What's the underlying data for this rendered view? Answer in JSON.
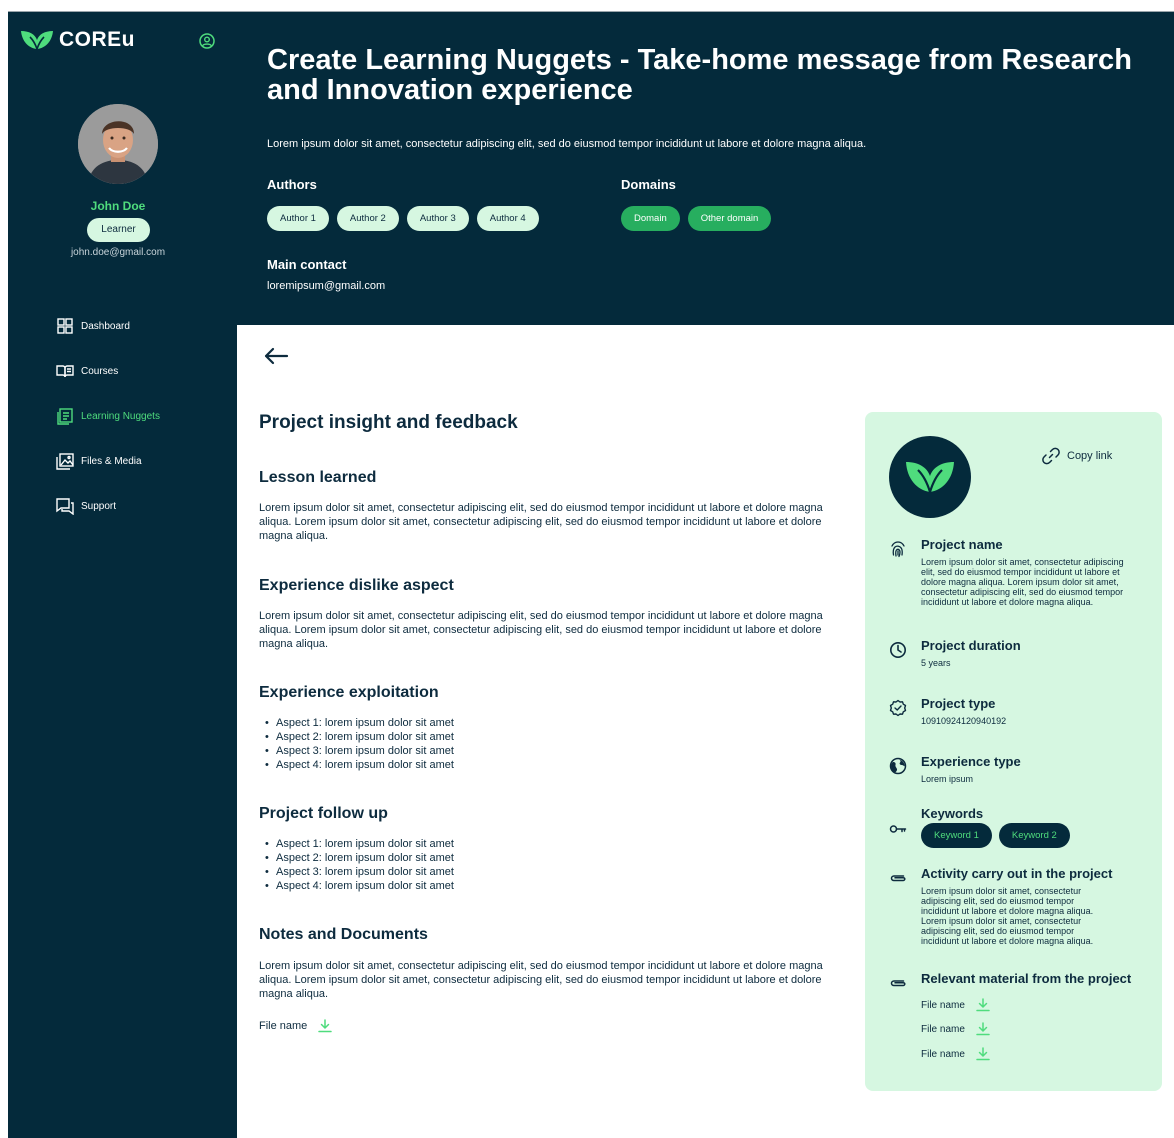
{
  "app": {
    "logo_text": "COREu"
  },
  "user": {
    "name": "John Doe",
    "role": "Learner",
    "email": "john.doe@gmail.com"
  },
  "nav": [
    {
      "label": "Dashboard",
      "icon": "grid-icon",
      "active": false
    },
    {
      "label": "Courses",
      "icon": "book-icon",
      "active": false
    },
    {
      "label": "Learning Nuggets",
      "icon": "document-list-icon",
      "active": true
    },
    {
      "label": "Files & Media",
      "icon": "image-folder-icon",
      "active": false
    },
    {
      "label": "Support",
      "icon": "chat-icon",
      "active": false
    }
  ],
  "header": {
    "title": "Create Learning Nuggets - Take-home message from Research and Innovation experience",
    "description": "Lorem ipsum dolor sit amet, consectetur adipiscing elit, sed do eiusmod tempor incididunt ut labore et dolore magna aliqua.",
    "authors_label": "Authors",
    "authors": [
      "Author 1",
      "Author 2",
      "Author 3",
      "Author 4"
    ],
    "domains_label": "Domains",
    "domains": [
      "Domain",
      "Other domain"
    ],
    "contact_label": "Main contact",
    "contact_email": "loremipsum@gmail.com"
  },
  "main": {
    "heading": "Project insight and feedback",
    "lesson": {
      "title": "Lesson learned",
      "text": "Lorem ipsum dolor sit amet, consectetur adipiscing elit, sed do eiusmod tempor incididunt ut labore et dolore magna aliqua. Lorem ipsum dolor sit amet, consectetur adipiscing elit, sed do eiusmod tempor incididunt ut labore et dolore magna aliqua."
    },
    "dislike": {
      "title": "Experience dislike aspect",
      "text": "Lorem ipsum dolor sit amet, consectetur adipiscing elit, sed do eiusmod tempor incididunt ut labore et dolore magna aliqua. Lorem ipsum dolor sit amet, consectetur adipiscing elit, sed do eiusmod tempor incididunt ut labore et dolore magna aliqua."
    },
    "exploitation": {
      "title": "Experience exploitation",
      "items": [
        "Aspect 1: lorem ipsum dolor sit amet",
        "Aspect 2: lorem ipsum dolor sit amet",
        "Aspect 3: lorem ipsum dolor sit amet",
        "Aspect 4: lorem ipsum dolor sit amet"
      ]
    },
    "followup": {
      "title": "Project follow up",
      "items": [
        "Aspect 1: lorem ipsum dolor sit amet",
        "Aspect 2: lorem ipsum dolor sit amet",
        "Aspect 3: lorem ipsum dolor sit amet",
        "Aspect 4: lorem ipsum dolor sit amet"
      ]
    },
    "notes": {
      "title": "Notes and Documents",
      "text": "Lorem ipsum dolor sit amet, consectetur adipiscing elit, sed do eiusmod tempor incididunt ut labore et dolore magna aliqua. Lorem ipsum dolor sit amet, consectetur adipiscing elit, sed do eiusmod tempor incididunt ut labore et dolore magna aliqua.",
      "file": "File name"
    }
  },
  "card": {
    "copy_link": "Copy link",
    "project_name": {
      "title": "Project name",
      "text": "Lorem ipsum dolor sit amet, consectetur adipiscing elit, sed do eiusmod tempor incididunt ut labore et dolore magna aliqua. Lorem ipsum dolor sit amet, consectetur adipiscing elit, sed do eiusmod tempor incididunt ut labore et dolore magna aliqua."
    },
    "duration": {
      "title": "Project duration",
      "text": "5 years"
    },
    "type": {
      "title": "Project type",
      "text": "10910924120940192"
    },
    "experience": {
      "title": "Experience type",
      "text": "Lorem ipsum"
    },
    "keywords": {
      "title": "Keywords",
      "items": [
        "Keyword 1",
        "Keyword 2"
      ]
    },
    "activity": {
      "title": "Activity carry out in the project",
      "text": "Lorem ipsum dolor sit amet, consectetur adipiscing elit, sed do eiusmod tempor incididunt ut labore et dolore magna aliqua. Lorem ipsum dolor sit amet, consectetur adipiscing elit, sed do eiusmod tempor incididunt ut labore et dolore magna aliqua."
    },
    "material": {
      "title": "Relevant material from the project",
      "files": [
        "File name",
        "File name",
        "File name"
      ]
    }
  },
  "colors": {
    "navy": "#042a3b",
    "green": "#4fdc7d",
    "mint": "#d6f7e1",
    "domain_green": "#27ae5f"
  }
}
